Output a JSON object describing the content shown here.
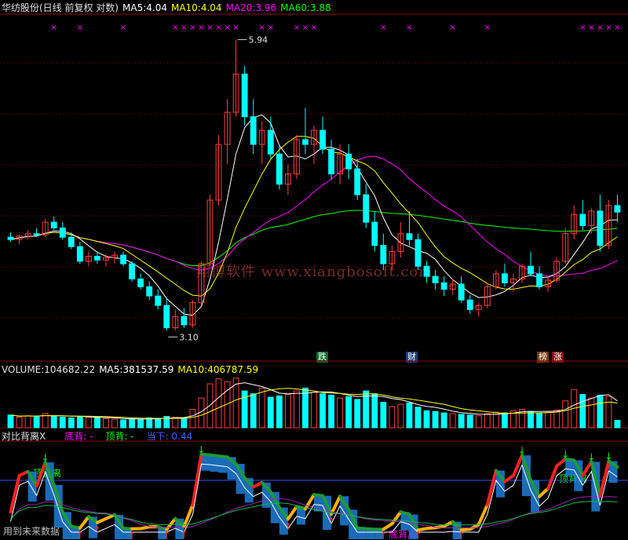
{
  "main_header": {
    "title": "华纺股份(日线 前复权 对数)",
    "ma5_label": "MA5:",
    "ma5_value": "4.04",
    "ma10_label": "MA10:",
    "ma10_value": "4.04",
    "ma20_label": "MA20:",
    "ma20_value": "3.96",
    "ma60_label": "MA60:",
    "ma60_value": "3.88"
  },
  "price_labels": {
    "high": "5.94",
    "low": "3.10"
  },
  "watermark": "翔博软件  www.xiangbosoft.com",
  "event_tags": [
    {
      "text": "跌",
      "color": "#ffffff",
      "bg": "#0d6b2a"
    },
    {
      "text": "财",
      "color": "#ffffff",
      "bg": "#1e3c78"
    },
    {
      "text": "榜",
      "color": "#ffffff",
      "bg": "#7a3a10"
    },
    {
      "text": "涨",
      "color": "#ffffff",
      "bg": "#8a1010"
    }
  ],
  "volume_header": {
    "volume_label": "VOLUME:",
    "volume_value": "104682.22",
    "ma5_label": "MA5:",
    "ma5_value": "381537.59",
    "ma10_label": "MA10:",
    "ma10_value": "406787.59"
  },
  "indicator_header": {
    "name": "对比背离X",
    "bottom_div_label": "底背: -",
    "top_div_label": "顶背: -",
    "current_label": "当下: 0.44"
  },
  "indicator_annotations": {
    "top_div_1": "顶背离",
    "top_div_2": "顶背离",
    "bottom_div": "底背离",
    "future_data": "用到未来数据"
  },
  "colors": {
    "up": "#ff3c3c",
    "down": "#00ffff",
    "ma5": "#ffffff",
    "ma10": "#ffff00",
    "ma20": "#ff00ff",
    "ma60": "#00ff00",
    "grid": "#8b0000",
    "marker": "#ff00ff"
  },
  "chart_data": [
    {
      "type": "candlestick",
      "title": "华纺股份(日线 前复权 对数)",
      "note": "approximate daily OHLC (yuan), values estimated from chart",
      "ohlc": [
        [
          3.82,
          3.86,
          3.78,
          3.8
        ],
        [
          3.8,
          3.84,
          3.76,
          3.83
        ],
        [
          3.83,
          3.88,
          3.8,
          3.85
        ],
        [
          3.85,
          3.9,
          3.82,
          3.84
        ],
        [
          3.84,
          3.98,
          3.82,
          3.95
        ],
        [
          3.95,
          4.0,
          3.88,
          3.9
        ],
        [
          3.9,
          3.95,
          3.8,
          3.82
        ],
        [
          3.82,
          3.86,
          3.72,
          3.74
        ],
        [
          3.74,
          3.78,
          3.6,
          3.62
        ],
        [
          3.62,
          3.7,
          3.58,
          3.66
        ],
        [
          3.66,
          3.7,
          3.6,
          3.63
        ],
        [
          3.63,
          3.68,
          3.58,
          3.65
        ],
        [
          3.65,
          3.7,
          3.6,
          3.67
        ],
        [
          3.67,
          3.7,
          3.58,
          3.6
        ],
        [
          3.6,
          3.62,
          3.46,
          3.48
        ],
        [
          3.48,
          3.52,
          3.4,
          3.42
        ],
        [
          3.42,
          3.46,
          3.32,
          3.35
        ],
        [
          3.35,
          3.4,
          3.25,
          3.28
        ],
        [
          3.28,
          3.33,
          3.1,
          3.12
        ],
        [
          3.12,
          3.25,
          3.1,
          3.2
        ],
        [
          3.2,
          3.26,
          3.12,
          3.14
        ],
        [
          3.14,
          3.32,
          3.12,
          3.3
        ],
        [
          3.3,
          3.62,
          3.28,
          3.6
        ],
        [
          3.6,
          4.2,
          3.58,
          4.15
        ],
        [
          4.15,
          4.8,
          4.1,
          4.7
        ],
        [
          4.7,
          5.2,
          4.5,
          5.05
        ],
        [
          5.05,
          5.94,
          5.0,
          5.5
        ],
        [
          5.5,
          5.6,
          4.9,
          5.0
        ],
        [
          5.0,
          5.2,
          4.6,
          4.7
        ],
        [
          4.7,
          4.95,
          4.5,
          4.85
        ],
        [
          4.85,
          5.0,
          4.55,
          4.6
        ],
        [
          4.6,
          4.7,
          4.25,
          4.3
        ],
        [
          4.3,
          4.5,
          4.2,
          4.4
        ],
        [
          4.4,
          4.8,
          4.35,
          4.75
        ],
        [
          4.75,
          5.1,
          4.6,
          4.7
        ],
        [
          4.7,
          4.9,
          4.5,
          4.85
        ],
        [
          4.85,
          5.0,
          4.6,
          4.65
        ],
        [
          4.65,
          4.75,
          4.35,
          4.4
        ],
        [
          4.4,
          4.7,
          4.3,
          4.6
        ],
        [
          4.6,
          4.7,
          4.35,
          4.45
        ],
        [
          4.45,
          4.55,
          4.15,
          4.2
        ],
        [
          4.2,
          4.3,
          3.9,
          3.95
        ],
        [
          3.95,
          4.05,
          3.7,
          3.75
        ],
        [
          3.75,
          3.85,
          3.55,
          3.6
        ],
        [
          3.6,
          3.75,
          3.55,
          3.7
        ],
        [
          3.7,
          3.95,
          3.65,
          3.85
        ],
        [
          3.85,
          4.05,
          3.75,
          3.8
        ],
        [
          3.8,
          3.85,
          3.55,
          3.58
        ],
        [
          3.58,
          3.62,
          3.45,
          3.5
        ],
        [
          3.5,
          3.55,
          3.4,
          3.45
        ],
        [
          3.45,
          3.5,
          3.35,
          3.4
        ],
        [
          3.4,
          3.48,
          3.36,
          3.44
        ],
        [
          3.44,
          3.5,
          3.3,
          3.32
        ],
        [
          3.32,
          3.36,
          3.22,
          3.25
        ],
        [
          3.25,
          3.3,
          3.2,
          3.28
        ],
        [
          3.28,
          3.45,
          3.26,
          3.42
        ],
        [
          3.42,
          3.55,
          3.4,
          3.52
        ],
        [
          3.52,
          3.6,
          3.42,
          3.45
        ],
        [
          3.45,
          3.52,
          3.38,
          3.48
        ],
        [
          3.48,
          3.6,
          3.45,
          3.58
        ],
        [
          3.58,
          3.7,
          3.5,
          3.52
        ],
        [
          3.52,
          3.58,
          3.4,
          3.42
        ],
        [
          3.42,
          3.5,
          3.38,
          3.47
        ],
        [
          3.47,
          3.65,
          3.45,
          3.62
        ],
        [
          3.62,
          3.9,
          3.6,
          3.85
        ],
        [
          3.85,
          4.1,
          3.8,
          4.02
        ],
        [
          4.02,
          4.15,
          3.88,
          3.92
        ],
        [
          3.92,
          4.08,
          3.85,
          4.05
        ],
        [
          4.05,
          4.2,
          3.7,
          3.75
        ],
        [
          3.75,
          4.15,
          3.72,
          4.1
        ],
        [
          4.1,
          4.2,
          3.95,
          4.04
        ]
      ],
      "ma5_last": 4.04,
      "ma10_last": 4.04,
      "ma20_last": 3.96,
      "ma60_last": 3.88,
      "annotations": [
        "5.94",
        "3.10"
      ]
    },
    {
      "type": "bar",
      "title": "VOLUME",
      "note": "approximate daily volume, values estimated from chart",
      "values": [
        180000,
        150000,
        170000,
        160000,
        200000,
        170000,
        150000,
        140000,
        160000,
        150000,
        140000,
        130000,
        120000,
        110000,
        130000,
        120000,
        140000,
        130000,
        160000,
        150000,
        140000,
        260000,
        420000,
        620000,
        690000,
        650000,
        700000,
        520000,
        480000,
        560000,
        430000,
        450000,
        470000,
        520000,
        560000,
        500000,
        480000,
        460000,
        420000,
        440000,
        400000,
        520000,
        480000,
        360000,
        300000,
        330000,
        350000,
        290000,
        240000,
        230000,
        210000,
        200000,
        190000,
        180000,
        170000,
        200000,
        220000,
        210000,
        240000,
        260000,
        230000,
        210000,
        220000,
        250000,
        380000,
        540000,
        470000,
        420000,
        460000,
        440000,
        104682.22
      ],
      "ma5_last": 381537.59,
      "ma10_last": 406787.59
    },
    {
      "type": "line",
      "title": "对比背离X",
      "series_values": "oscillator, range 0 to 1, current 0.44"
    }
  ]
}
